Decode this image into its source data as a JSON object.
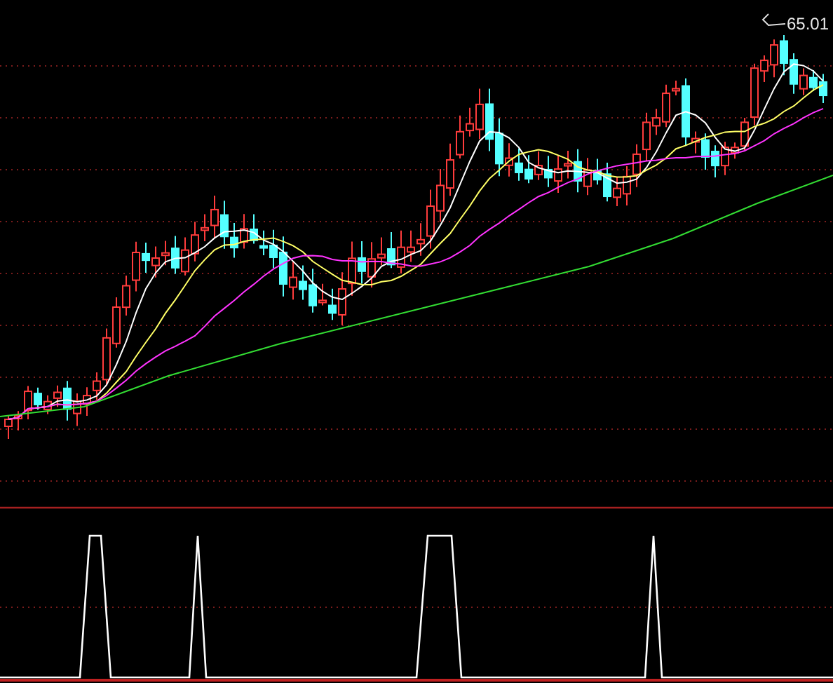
{
  "chart": {
    "high_label": "65.01"
  }
}
